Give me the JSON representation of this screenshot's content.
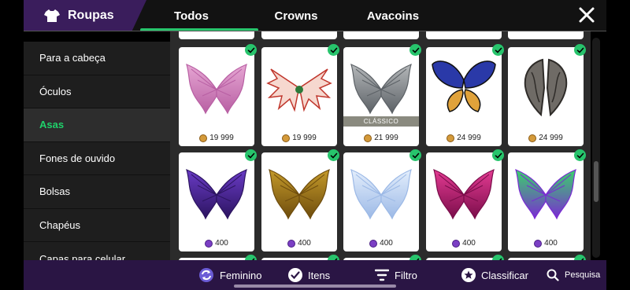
{
  "header": {
    "brand_label": "Roupas",
    "tabs": [
      "Todos",
      "Crowns",
      "Avacoins"
    ],
    "active_tab": "Todos"
  },
  "sidebar": {
    "categories": [
      "Para a cabeça",
      "Óculos",
      "Asas",
      "Fones de ouvido",
      "Bolsas",
      "Chapéus",
      "Capas para celular"
    ],
    "active": "Asas"
  },
  "items": [
    {
      "price": "19 999",
      "currency": "gold-coin",
      "wing": "pink-bat",
      "colors": [
        "#e6a6d3",
        "#b85fa3"
      ]
    },
    {
      "price": "19 999",
      "currency": "gold-coin",
      "wing": "red-white-leaf",
      "colors": [
        "#f6d8cf",
        "#c0362c"
      ]
    },
    {
      "price": "21 999",
      "currency": "gold-coin",
      "wing": "grey-bat",
      "colors": [
        "#b5b8ba",
        "#5c6166"
      ],
      "badge": "CLÁSSICO"
    },
    {
      "price": "24 999",
      "currency": "gold-coin",
      "wing": "blue-orange-butterfly",
      "colors": [
        "#2a39a8",
        "#e0a23a"
      ]
    },
    {
      "price": "24 999",
      "currency": "gold-coin",
      "wing": "stone-dark",
      "colors": [
        "#6f6b66",
        "#2f2c29"
      ]
    },
    {
      "price": "400",
      "currency": "crown",
      "wing": "purple-bat",
      "colors": [
        "#6a3bc6",
        "#2c1460"
      ]
    },
    {
      "price": "400",
      "currency": "crown",
      "wing": "gold-bat",
      "colors": [
        "#c49a2a",
        "#6e4c0d"
      ]
    },
    {
      "price": "400",
      "currency": "crown",
      "wing": "white-blue-bat",
      "colors": [
        "#e3eefc",
        "#9cb9e6"
      ]
    },
    {
      "price": "400",
      "currency": "crown",
      "wing": "pink-magenta-bat",
      "colors": [
        "#e43b93",
        "#7a0d4a"
      ]
    },
    {
      "price": "400",
      "currency": "crown",
      "wing": "rainbow-bat",
      "colors": [
        "#39d36a",
        "#7a2bd3"
      ]
    }
  ],
  "bottombar": {
    "feminino": "Feminino",
    "itens": "Itens",
    "filtro": "Filtro",
    "classificar": "Classificar",
    "pesquisa": "Pesquisa"
  },
  "colors": {
    "accent_green": "#27c46c",
    "brand_purple": "#3a1d5c",
    "bottom_purple": "#2a1544"
  }
}
